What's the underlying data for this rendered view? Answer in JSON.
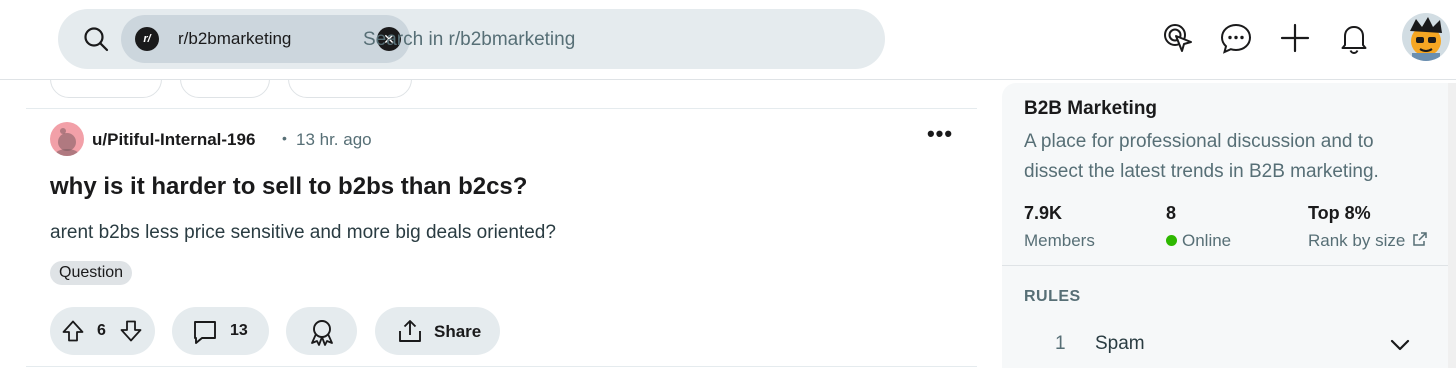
{
  "header": {
    "search_chip_label": "r/b2bmarketing",
    "search_chip_icon": "r/",
    "search_placeholder": "Search in r/b2bmarketing",
    "icons": [
      "search-icon",
      "advertise-icon",
      "chat-icon",
      "create-icon",
      "notifications-icon",
      "avatar"
    ]
  },
  "post": {
    "author": "u/Pitiful-Internal-196",
    "separator": "•",
    "time": "13 hr. ago",
    "more": "•••",
    "title": "why is it harder to sell to b2bs than b2cs?",
    "body": "arent b2bs less price sensitive and more big deals oriented?",
    "flair": "Question",
    "votes": "6",
    "comments": "13",
    "share_label": "Share"
  },
  "sidebar": {
    "title": "B2B Marketing",
    "description": "A place for professional discussion and to dissect the latest trends in B2B marketing.",
    "stats": [
      {
        "value": "7.9K",
        "label": "Members"
      },
      {
        "value": "8",
        "label": "Online"
      },
      {
        "value": "Top 8%",
        "label": "Rank by size"
      }
    ],
    "rules_heading": "RULES",
    "rules": [
      {
        "number": "1",
        "label": "Spam"
      }
    ]
  },
  "colors": {
    "search_bg": "#e5ebee",
    "chip_bg": "#ccd6dd",
    "online": "#2eb800",
    "muted_text": "#576f76",
    "sidebar_bg": "#f6f8f9"
  }
}
